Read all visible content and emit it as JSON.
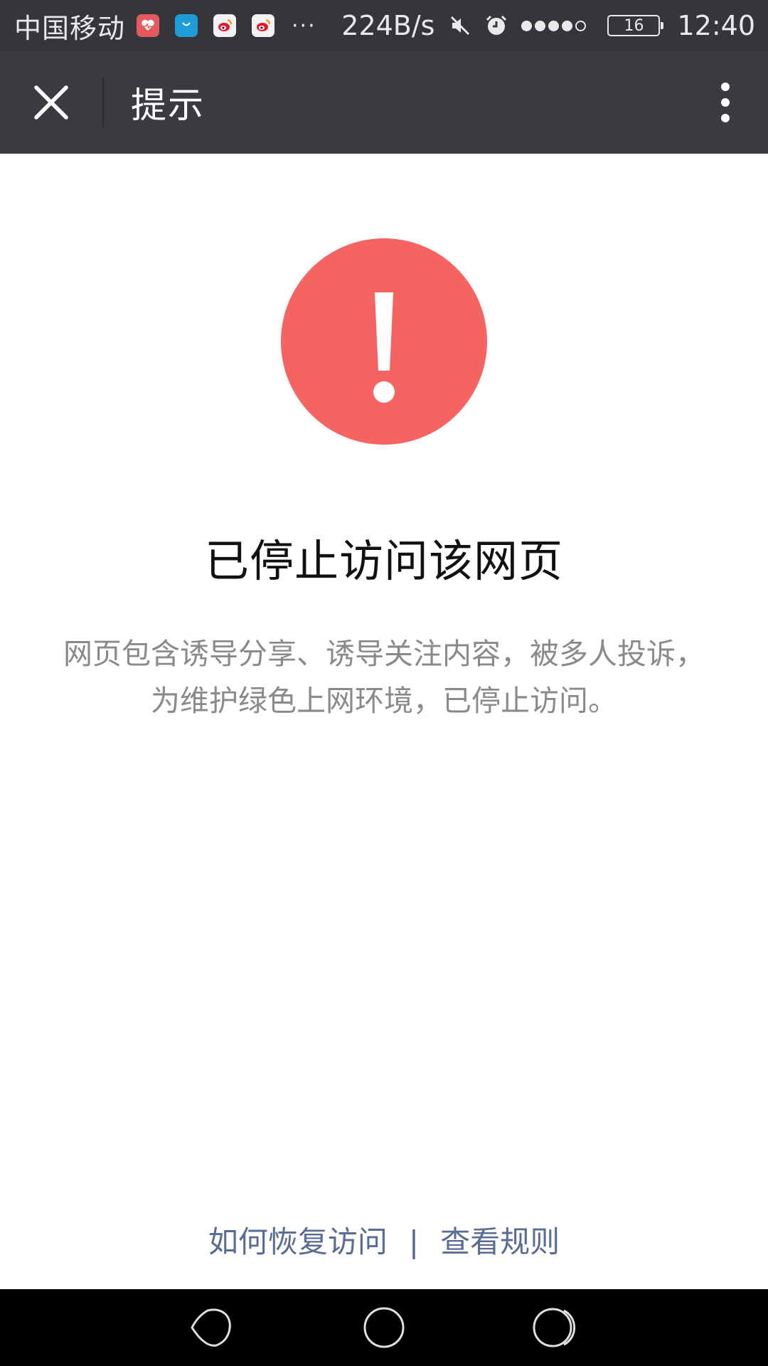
{
  "status_bar": {
    "carrier": "中国移动",
    "more": "···",
    "net_speed": "224B/s",
    "battery": "16",
    "time": "12:40",
    "notification_icons": [
      "health-icon",
      "shopping-bag-icon",
      "weibo-icon",
      "weibo-icon"
    ],
    "system_icons": [
      "mute-icon",
      "alarm-icon",
      "signal-icon",
      "battery-icon"
    ],
    "signal_strength": 4,
    "signal_max": 5
  },
  "nav_bar": {
    "title": "提示",
    "close_icon": "close-icon",
    "menu_icon": "more-vertical-icon"
  },
  "content": {
    "icon": "exclamation-icon",
    "title": "已停止访问该网页",
    "description_line1": "网页包含诱导分享、诱导关注内容，被多人投诉，",
    "description_line2": "为维护绿色上网环境，已停止访问。"
  },
  "footer": {
    "link_recover": "如何恢复访问",
    "separator": "|",
    "link_rules": "查看规则"
  },
  "system_nav": {
    "buttons": [
      "back-icon",
      "home-icon",
      "recents-icon"
    ]
  },
  "colors": {
    "status_bar_bg": "#35363b",
    "nav_bar_bg": "#3a3b40",
    "warning_red": "#f66461",
    "link_blue": "#586c94",
    "description_gray": "#8a8a8a"
  }
}
